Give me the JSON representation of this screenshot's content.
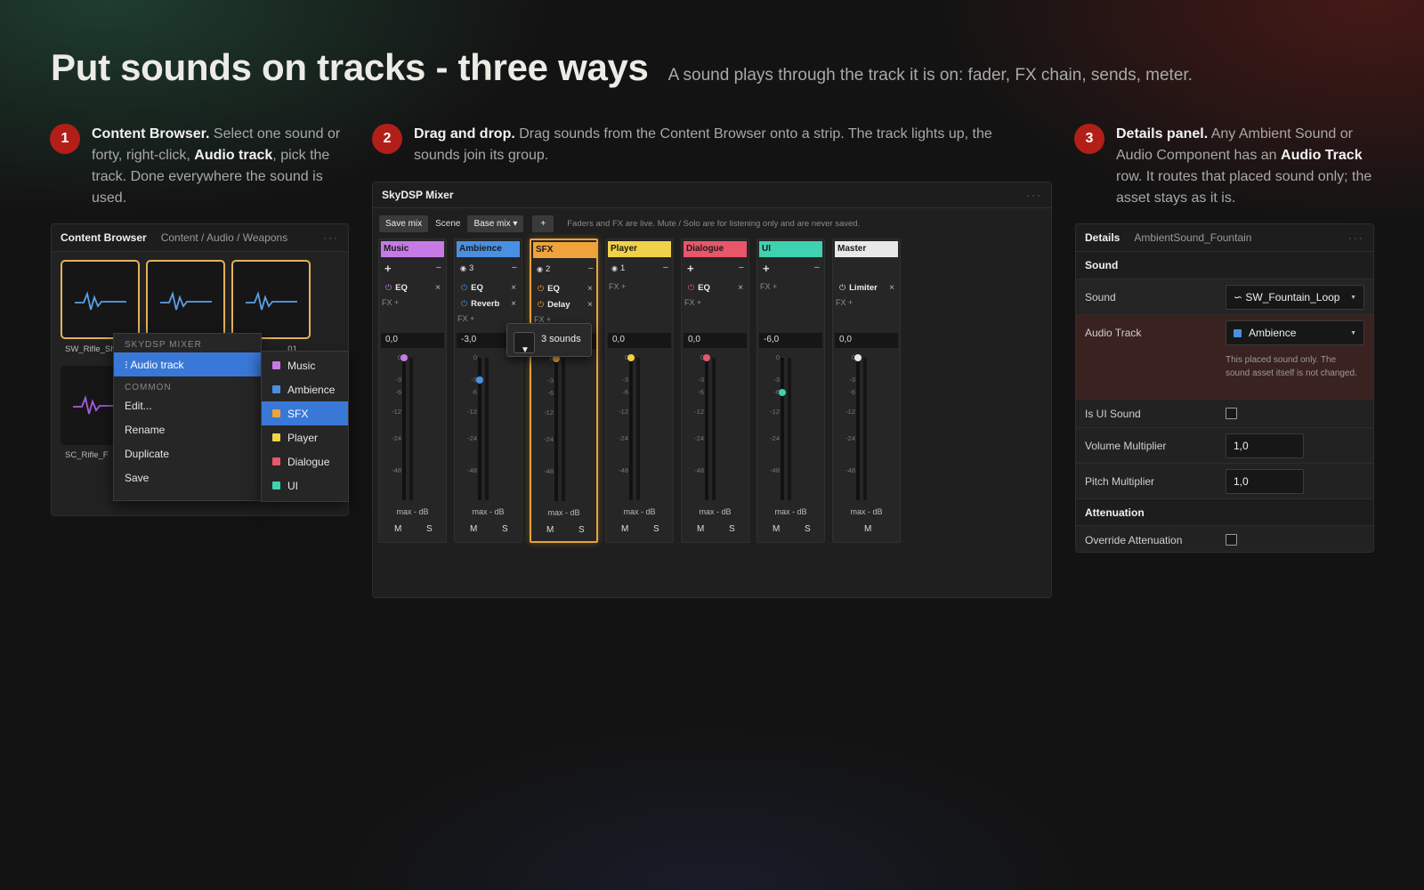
{
  "hero": {
    "title": "Put sounds on tracks - three ways",
    "subtitle": "A sound plays through the track it is on: fader, FX chain, sends, meter."
  },
  "steps": [
    {
      "num": "1",
      "title": "Content Browser.",
      "text_a": " Select one sound or forty, right-click, ",
      "bold": "Audio track",
      "text_b": ", pick the track. Done everywhere the sound is used."
    },
    {
      "num": "2",
      "title": "Drag and drop.",
      "text_a": " Drag sounds from the Content Browser onto a strip. The track lights up, the sounds join its group.",
      "bold": "",
      "text_b": ""
    },
    {
      "num": "3",
      "title": "Details panel.",
      "text_a": " Any Ambient Sound or Audio Component has an ",
      "bold": "Audio Track",
      "text_b": " row. It routes that placed sound only; the asset stays as it is."
    }
  ],
  "browser": {
    "title": "Content Browser",
    "path": "Content / Audio / Weapons",
    "more": "···",
    "assets": [
      {
        "label": "SW_Rifle_Sh",
        "color": "#5aa0e8"
      },
      {
        "label": "",
        "color": "#5aa0e8"
      },
      {
        "label": "_01",
        "color": "#5aa0e8"
      },
      {
        "label": "SC_Rifle_F",
        "color": "#a35ee0"
      }
    ],
    "context": {
      "section1": "SKYDSP MIXER",
      "audio_track": "⁝ Audio track",
      "section2": "COMMON",
      "items": [
        "Edit...",
        "Rename",
        "Duplicate",
        "Save"
      ]
    },
    "submenu": [
      {
        "label": "Music",
        "color": "#c77ae6"
      },
      {
        "label": "Ambience",
        "color": "#4a90e2"
      },
      {
        "label": "SFX",
        "color": "#f0a33a"
      },
      {
        "label": "Player",
        "color": "#f0d24a"
      },
      {
        "label": "Dialogue",
        "color": "#e8566a"
      },
      {
        "label": "UI",
        "color": "#3fd1b0"
      }
    ]
  },
  "mixer": {
    "title": "SkyDSP Mixer",
    "more": "···",
    "toolbar": {
      "save": "Save mix",
      "scene": "Scene",
      "base": "Base mix ▾",
      "plus": "+",
      "note": "Faders and FX are live. Mute / Solo are for listening only and are never saved."
    },
    "scale": [
      "0",
      "-3",
      "-6",
      "-12",
      "-24",
      "-48"
    ],
    "maxdb": "max - dB",
    "fxplus": "FX +",
    "mute": "M",
    "solo": "S",
    "close": "×",
    "minus": "−",
    "addsign": "+",
    "eyeglyph": "◉",
    "powerglyph": "⏻",
    "strips": [
      {
        "name": "Music",
        "color": "#c77ae6",
        "count": "",
        "fx": [
          "EQ"
        ],
        "value": "0,0",
        "level": 0,
        "solo": true
      },
      {
        "name": "Ambience",
        "color": "#4a90e2",
        "count": "3",
        "fx": [
          "EQ",
          "Reverb"
        ],
        "value": "-3,0",
        "level": -3,
        "solo": true
      },
      {
        "name": "SFX",
        "color": "#f0a33a",
        "count": "2",
        "fx": [
          "EQ",
          "Delay"
        ],
        "value": "0,0",
        "level": 0,
        "solo": true
      },
      {
        "name": "Player",
        "color": "#f0d24a",
        "count": "1",
        "fx": [],
        "value": "0,0",
        "level": 0,
        "solo": true
      },
      {
        "name": "Dialogue",
        "color": "#e8566a",
        "count": "",
        "fx": [
          "EQ"
        ],
        "value": "0,0",
        "level": 0,
        "solo": true
      },
      {
        "name": "UI",
        "color": "#3fd1b0",
        "count": "",
        "fx": [],
        "value": "-6,0",
        "level": -6,
        "solo": true
      },
      {
        "name": "Master",
        "color": "#e8e8e8",
        "count": "",
        "fx": [
          "Limiter"
        ],
        "value": "0,0",
        "level": 0,
        "solo": false
      }
    ],
    "drag_tooltip": "3 sounds"
  },
  "details": {
    "title": "Details",
    "object": "AmbientSound_Fountain",
    "more": "···",
    "section_sound": "Sound",
    "sound_label": "Sound",
    "sound_value": "∽ SW_Fountain_Loop",
    "track_label": "Audio Track",
    "track_value": "Ambience",
    "track_color": "#4a90e2",
    "track_note": "This placed sound only. The sound asset itself is not changed.",
    "ui_label": "Is UI Sound",
    "volume_label": "Volume Multiplier",
    "volume_value": "1,0",
    "pitch_label": "Pitch Multiplier",
    "pitch_value": "1,0",
    "section_atten": "Attenuation",
    "override_label": "Override Attenuation"
  }
}
